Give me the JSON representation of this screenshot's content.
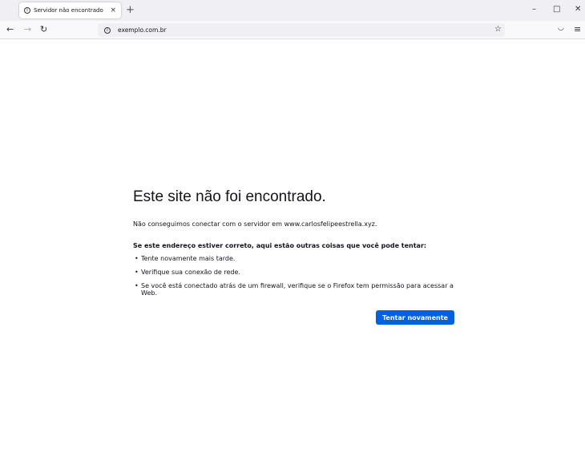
{
  "tab": {
    "title": "Servidor não encontrado",
    "close": "×",
    "new_tab": "+"
  },
  "window": {
    "minimize": "–",
    "maximize": "□",
    "close": "✕"
  },
  "nav": {
    "back": "←",
    "forward": "→",
    "reload": "↻",
    "url": "exemplo.com.br",
    "star": "☆",
    "pocket": "◡",
    "menu": "≡"
  },
  "error": {
    "title": "Este site não foi encontrado.",
    "message": "Não conseguimos conectar com o servidor em www.carlosfelipeestrella.xyz.",
    "suggestions_heading": "Se este endereço estiver correto, aqui estão outras coisas que você pode tentar:",
    "suggestions": [
      "Tente novamente mais tarde.",
      "Verifique sua conexão de rede.",
      "Se você está conectado atrás de um firewall, verifique se o Firefox tem permissão para acessar a Web."
    ],
    "retry_button": "Tentar novamente"
  }
}
